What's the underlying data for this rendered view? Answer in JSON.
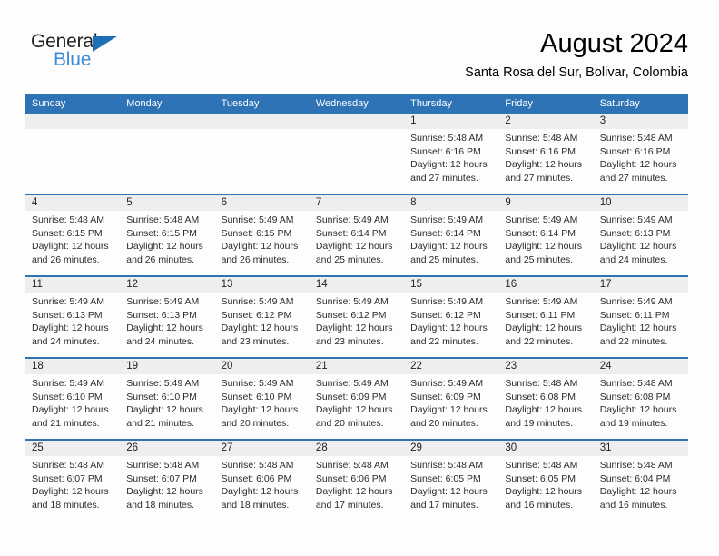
{
  "logo": {
    "word_dark": "General",
    "word_blue": "Blue",
    "triangle_color": "#1d6fb8",
    "blue_color": "#3c8dd4"
  },
  "header": {
    "title": "August 2024",
    "subtitle": "Santa Rosa del Sur, Bolivar, Colombia"
  },
  "theme": {
    "header_blue": "#2d73b5",
    "date_strip_gray": "#eeeeee",
    "page_bg": "#fdfdfd"
  },
  "weekdays": [
    "Sunday",
    "Monday",
    "Tuesday",
    "Wednesday",
    "Thursday",
    "Friday",
    "Saturday"
  ],
  "weeks": [
    {
      "days": [
        {
          "date": "",
          "lines": []
        },
        {
          "date": "",
          "lines": []
        },
        {
          "date": "",
          "lines": []
        },
        {
          "date": "",
          "lines": []
        },
        {
          "date": "1",
          "lines": [
            "Sunrise: 5:48 AM",
            "Sunset: 6:16 PM",
            "Daylight: 12 hours",
            "and 27 minutes."
          ]
        },
        {
          "date": "2",
          "lines": [
            "Sunrise: 5:48 AM",
            "Sunset: 6:16 PM",
            "Daylight: 12 hours",
            "and 27 minutes."
          ]
        },
        {
          "date": "3",
          "lines": [
            "Sunrise: 5:48 AM",
            "Sunset: 6:16 PM",
            "Daylight: 12 hours",
            "and 27 minutes."
          ]
        }
      ]
    },
    {
      "days": [
        {
          "date": "4",
          "lines": [
            "Sunrise: 5:48 AM",
            "Sunset: 6:15 PM",
            "Daylight: 12 hours",
            "and 26 minutes."
          ]
        },
        {
          "date": "5",
          "lines": [
            "Sunrise: 5:48 AM",
            "Sunset: 6:15 PM",
            "Daylight: 12 hours",
            "and 26 minutes."
          ]
        },
        {
          "date": "6",
          "lines": [
            "Sunrise: 5:49 AM",
            "Sunset: 6:15 PM",
            "Daylight: 12 hours",
            "and 26 minutes."
          ]
        },
        {
          "date": "7",
          "lines": [
            "Sunrise: 5:49 AM",
            "Sunset: 6:14 PM",
            "Daylight: 12 hours",
            "and 25 minutes."
          ]
        },
        {
          "date": "8",
          "lines": [
            "Sunrise: 5:49 AM",
            "Sunset: 6:14 PM",
            "Daylight: 12 hours",
            "and 25 minutes."
          ]
        },
        {
          "date": "9",
          "lines": [
            "Sunrise: 5:49 AM",
            "Sunset: 6:14 PM",
            "Daylight: 12 hours",
            "and 25 minutes."
          ]
        },
        {
          "date": "10",
          "lines": [
            "Sunrise: 5:49 AM",
            "Sunset: 6:13 PM",
            "Daylight: 12 hours",
            "and 24 minutes."
          ]
        }
      ]
    },
    {
      "days": [
        {
          "date": "11",
          "lines": [
            "Sunrise: 5:49 AM",
            "Sunset: 6:13 PM",
            "Daylight: 12 hours",
            "and 24 minutes."
          ]
        },
        {
          "date": "12",
          "lines": [
            "Sunrise: 5:49 AM",
            "Sunset: 6:13 PM",
            "Daylight: 12 hours",
            "and 24 minutes."
          ]
        },
        {
          "date": "13",
          "lines": [
            "Sunrise: 5:49 AM",
            "Sunset: 6:12 PM",
            "Daylight: 12 hours",
            "and 23 minutes."
          ]
        },
        {
          "date": "14",
          "lines": [
            "Sunrise: 5:49 AM",
            "Sunset: 6:12 PM",
            "Daylight: 12 hours",
            "and 23 minutes."
          ]
        },
        {
          "date": "15",
          "lines": [
            "Sunrise: 5:49 AM",
            "Sunset: 6:12 PM",
            "Daylight: 12 hours",
            "and 22 minutes."
          ]
        },
        {
          "date": "16",
          "lines": [
            "Sunrise: 5:49 AM",
            "Sunset: 6:11 PM",
            "Daylight: 12 hours",
            "and 22 minutes."
          ]
        },
        {
          "date": "17",
          "lines": [
            "Sunrise: 5:49 AM",
            "Sunset: 6:11 PM",
            "Daylight: 12 hours",
            "and 22 minutes."
          ]
        }
      ]
    },
    {
      "days": [
        {
          "date": "18",
          "lines": [
            "Sunrise: 5:49 AM",
            "Sunset: 6:10 PM",
            "Daylight: 12 hours",
            "and 21 minutes."
          ]
        },
        {
          "date": "19",
          "lines": [
            "Sunrise: 5:49 AM",
            "Sunset: 6:10 PM",
            "Daylight: 12 hours",
            "and 21 minutes."
          ]
        },
        {
          "date": "20",
          "lines": [
            "Sunrise: 5:49 AM",
            "Sunset: 6:10 PM",
            "Daylight: 12 hours",
            "and 20 minutes."
          ]
        },
        {
          "date": "21",
          "lines": [
            "Sunrise: 5:49 AM",
            "Sunset: 6:09 PM",
            "Daylight: 12 hours",
            "and 20 minutes."
          ]
        },
        {
          "date": "22",
          "lines": [
            "Sunrise: 5:49 AM",
            "Sunset: 6:09 PM",
            "Daylight: 12 hours",
            "and 20 minutes."
          ]
        },
        {
          "date": "23",
          "lines": [
            "Sunrise: 5:48 AM",
            "Sunset: 6:08 PM",
            "Daylight: 12 hours",
            "and 19 minutes."
          ]
        },
        {
          "date": "24",
          "lines": [
            "Sunrise: 5:48 AM",
            "Sunset: 6:08 PM",
            "Daylight: 12 hours",
            "and 19 minutes."
          ]
        }
      ]
    },
    {
      "days": [
        {
          "date": "25",
          "lines": [
            "Sunrise: 5:48 AM",
            "Sunset: 6:07 PM",
            "Daylight: 12 hours",
            "and 18 minutes."
          ]
        },
        {
          "date": "26",
          "lines": [
            "Sunrise: 5:48 AM",
            "Sunset: 6:07 PM",
            "Daylight: 12 hours",
            "and 18 minutes."
          ]
        },
        {
          "date": "27",
          "lines": [
            "Sunrise: 5:48 AM",
            "Sunset: 6:06 PM",
            "Daylight: 12 hours",
            "and 18 minutes."
          ]
        },
        {
          "date": "28",
          "lines": [
            "Sunrise: 5:48 AM",
            "Sunset: 6:06 PM",
            "Daylight: 12 hours",
            "and 17 minutes."
          ]
        },
        {
          "date": "29",
          "lines": [
            "Sunrise: 5:48 AM",
            "Sunset: 6:05 PM",
            "Daylight: 12 hours",
            "and 17 minutes."
          ]
        },
        {
          "date": "30",
          "lines": [
            "Sunrise: 5:48 AM",
            "Sunset: 6:05 PM",
            "Daylight: 12 hours",
            "and 16 minutes."
          ]
        },
        {
          "date": "31",
          "lines": [
            "Sunrise: 5:48 AM",
            "Sunset: 6:04 PM",
            "Daylight: 12 hours",
            "and 16 minutes."
          ]
        }
      ]
    }
  ]
}
